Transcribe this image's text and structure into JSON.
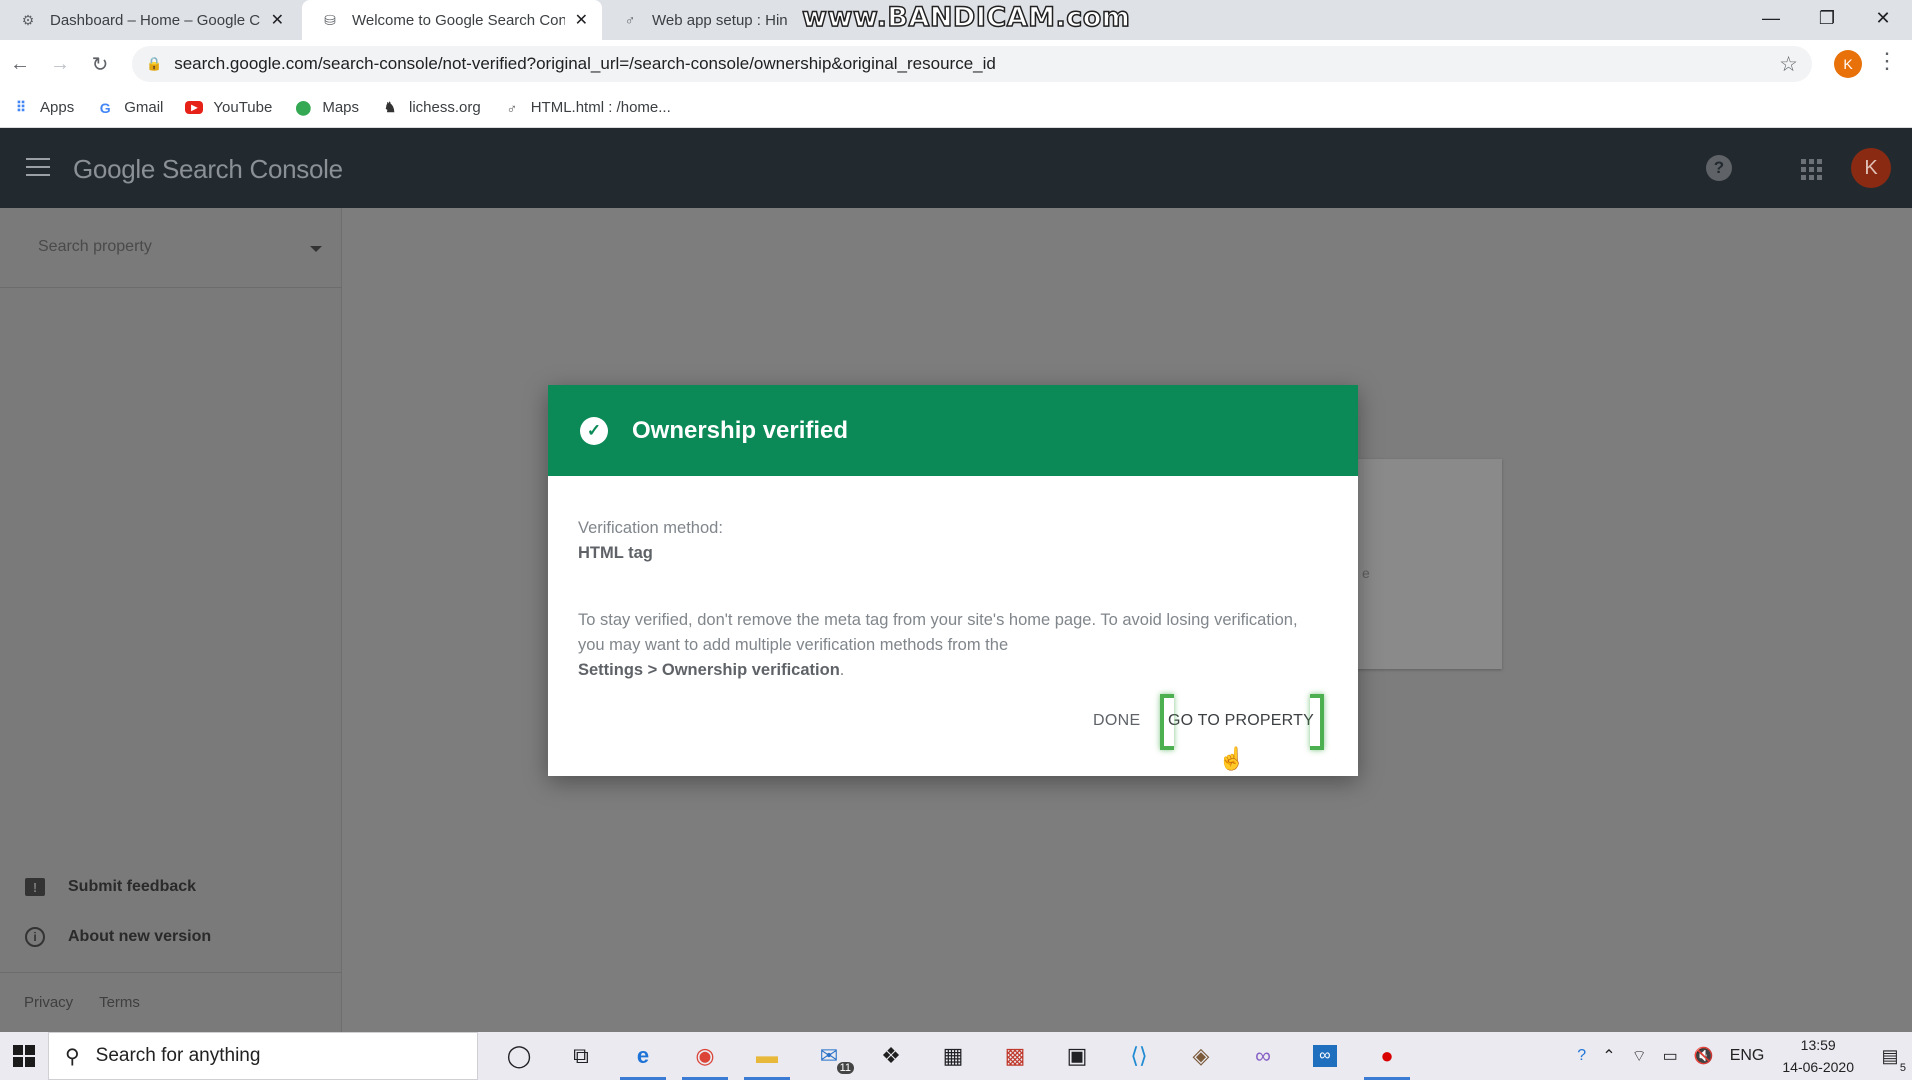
{
  "browser": {
    "tabs": [
      {
        "title": "Dashboard – Home – Google Clo",
        "active": false
      },
      {
        "title": "Welcome to Google Search Cons",
        "active": true
      },
      {
        "title": "Web app setup : HinKan",
        "active": false
      }
    ],
    "url": "search.google.com/search-console/not-verified?original_url=/search-console/ownership&original_resource_id",
    "profile_initial": "K",
    "watermark": "www.BANDICAM.com",
    "bookmarks": [
      {
        "label": "Apps",
        "icon": "apps-grid-icon"
      },
      {
        "label": "Gmail",
        "icon": "google-g-icon"
      },
      {
        "label": "YouTube",
        "icon": "youtube-icon"
      },
      {
        "label": "Maps",
        "icon": "maps-pin-icon"
      },
      {
        "label": "lichess.org",
        "icon": "lichess-icon"
      },
      {
        "label": "HTML.html : /home...",
        "icon": "file-icon"
      }
    ]
  },
  "app": {
    "logo": "Google Search Console",
    "avatar_initial": "K"
  },
  "sidebar": {
    "search_placeholder": "Search property",
    "submit_feedback": "Submit feedback",
    "about_new_version": "About new version",
    "privacy": "Privacy",
    "terms": "Terms"
  },
  "background": {
    "partial_text": "e"
  },
  "dialog": {
    "title": "Ownership verified",
    "method_label": "Verification method:",
    "method_value": "HTML tag",
    "description_prefix": "To stay verified, don't remove the meta tag from your site's home page. To avoid losing verification, you may want to add multiple verification methods from the",
    "description_link": "Settings > Ownership verification",
    "description_suffix": ".",
    "done_label": "DONE",
    "go_to_property_label": "GO TO PROPERTY"
  },
  "taskbar": {
    "search_placeholder": "Search for anything",
    "mail_badge": "11",
    "language": "ENG",
    "time": "13:59",
    "date": "14-06-2020",
    "notification_count": "5"
  },
  "colors": {
    "dialog_header": "#0b8a57",
    "appbar": "#222a2f",
    "highlight": "#4caf50"
  }
}
